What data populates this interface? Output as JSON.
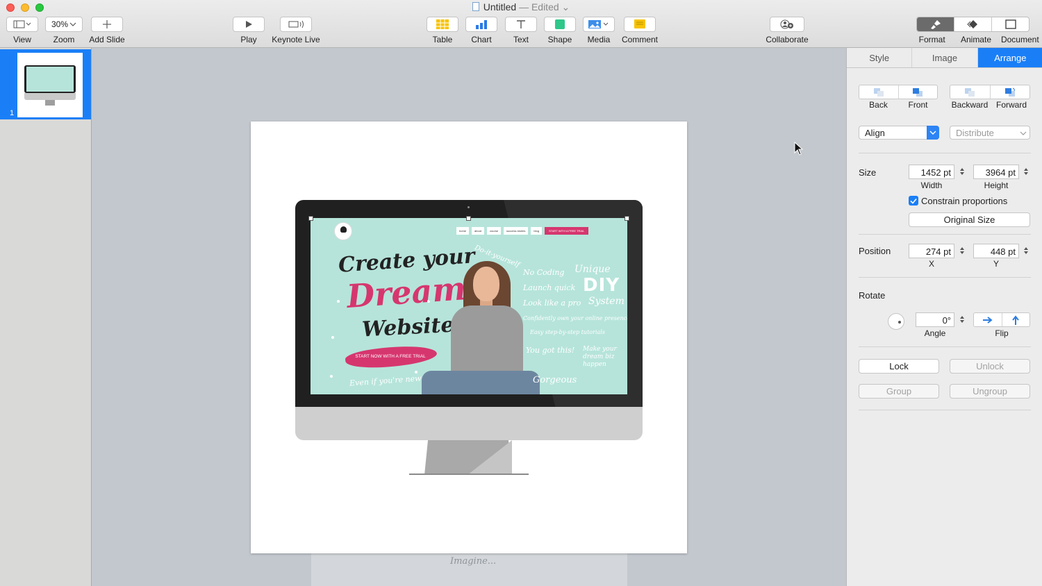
{
  "window": {
    "title": "Untitled",
    "edited": "— Edited"
  },
  "toolbar": {
    "view": "View",
    "zoom_value": "30%",
    "zoom": "Zoom",
    "add_slide": "Add Slide",
    "play": "Play",
    "keynote_live": "Keynote Live",
    "table": "Table",
    "chart": "Chart",
    "text": "Text",
    "shape": "Shape",
    "media": "Media",
    "comment": "Comment",
    "collaborate": "Collaborate",
    "format": "Format",
    "animate": "Animate",
    "document": "Document"
  },
  "navigator": {
    "slide_number": "1"
  },
  "website": {
    "menu": [
      "home",
      "about",
      "course",
      "success stories",
      "blog"
    ],
    "cta": "START WITH A FREE TRIAL",
    "headline_1": "Create your",
    "headline_2": "Dream",
    "headline_3": "Website",
    "start_now": "START NOW WITH A FREE TRIAL",
    "even_if": "Even if you're new",
    "do_it": "Do-it-yourself",
    "features": [
      "No Coding",
      "Launch quick",
      "Look like a pro"
    ],
    "unique": "Unique",
    "diy": "DIY",
    "system": "System",
    "confidently": "Confidently own your online presence",
    "tutorials": "Easy step-by-step tutorials",
    "you_got_this": "You got this!",
    "make_dream": "Make your dream biz happen",
    "gorgeous": "Gorgeous"
  },
  "offslide_text": "Imagine...",
  "inspector": {
    "tabs": [
      "Style",
      "Image",
      "Arrange"
    ],
    "active_tab": "Arrange",
    "back": "Back",
    "front": "Front",
    "backward": "Backward",
    "forward": "Forward",
    "align": "Align",
    "distribute": "Distribute",
    "size_label": "Size",
    "width_value": "1452 pt",
    "width_label": "Width",
    "height_value": "3964 pt",
    "height_label": "Height",
    "constrain": "Constrain proportions",
    "original_size": "Original Size",
    "position_label": "Position",
    "x_value": "274 pt",
    "x_label": "X",
    "y_value": "448 pt",
    "y_label": "Y",
    "rotate_label": "Rotate",
    "angle_value": "0°",
    "angle_label": "Angle",
    "flip_label": "Flip",
    "lock": "Lock",
    "unlock": "Unlock",
    "group": "Group",
    "ungroup": "Ungroup"
  },
  "colors": {
    "accent": "#1a7ff7",
    "site_mint": "#b6e4da",
    "site_pink": "#d6366e"
  }
}
